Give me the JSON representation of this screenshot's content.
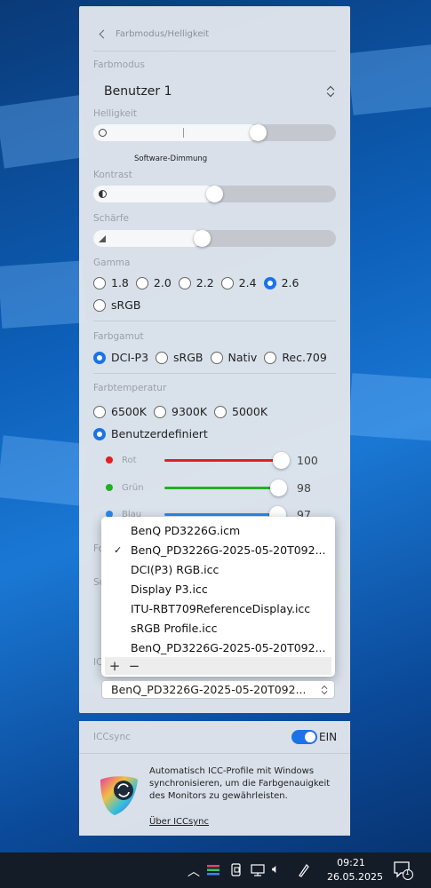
{
  "panel": {
    "back_label": "Farbmodus/Helligkeit",
    "farbmodus_label": "Farbmodus",
    "farbmodus_value": "Benutzer 1",
    "helligkeit_label": "Helligkeit",
    "helligkeit_level": 0.68,
    "software_dimming_label": "Software-Dimmung",
    "kontrast_label": "Kontrast",
    "kontrast_level": 0.5,
    "schaerfe_label": "Schärfe",
    "schaerfe_level": 0.45,
    "gamma_label": "Gamma",
    "gamma_options": [
      "1.8",
      "2.0",
      "2.2",
      "2.4",
      "2.6",
      "sRGB"
    ],
    "gamma_selected": "2.6",
    "farbgamut_label": "Farbgamut",
    "farbgamut_options": [
      "DCI-P3",
      "sRGB",
      "Nativ",
      "Rec.709"
    ],
    "farbgamut_selected": "DCI-P3",
    "farbtemp_label": "Farbtemperatur",
    "farbtemp_options": [
      "6500K",
      "9300K",
      "5000K",
      "Benutzerdefiniert"
    ],
    "farbtemp_selected": "Benutzerdefiniert",
    "rgb": [
      {
        "label": "Rot",
        "value": "100",
        "color": "#e02020"
      },
      {
        "label": "Grün",
        "value": "98",
        "color": "#22b022"
      },
      {
        "label": "Blau",
        "value": "97",
        "color": "#2a8ae8"
      }
    ],
    "hidden_labels": [
      "Fo",
      "Sc",
      "ICC"
    ]
  },
  "icc_popup": {
    "items": [
      "BenQ PD3226G.icm",
      "BenQ_PD3226G-2025-05-20T092...",
      "DCI(P3) RGB.icc",
      "Display P3.icc",
      "ITU-RBT709ReferenceDisplay.icc",
      "sRGB Profile.icc",
      "BenQ_PD3226G-2025-05-20T092..."
    ],
    "checked_index": 1,
    "add_label": "+",
    "remove_label": "−"
  },
  "icc_select": {
    "value": "BenQ_PD3226G-2025-05-20T092..."
  },
  "iccsync": {
    "title": "ICCsync",
    "toggle_label": "EIN",
    "toggle_on": true,
    "description": "Automatisch ICC-Profile mit Windows synchronisieren, um die Farbgenauigkeit des Monitors zu gewährleisten.",
    "link": "Über ICCsync"
  },
  "taskbar": {
    "time": "09:21",
    "date": "26.05.2025",
    "notification_count": "1"
  },
  "colors": {
    "accent": "#1a73e8",
    "panel_bg": "#e2e6ec",
    "taskbar_bg": "#141c28"
  }
}
